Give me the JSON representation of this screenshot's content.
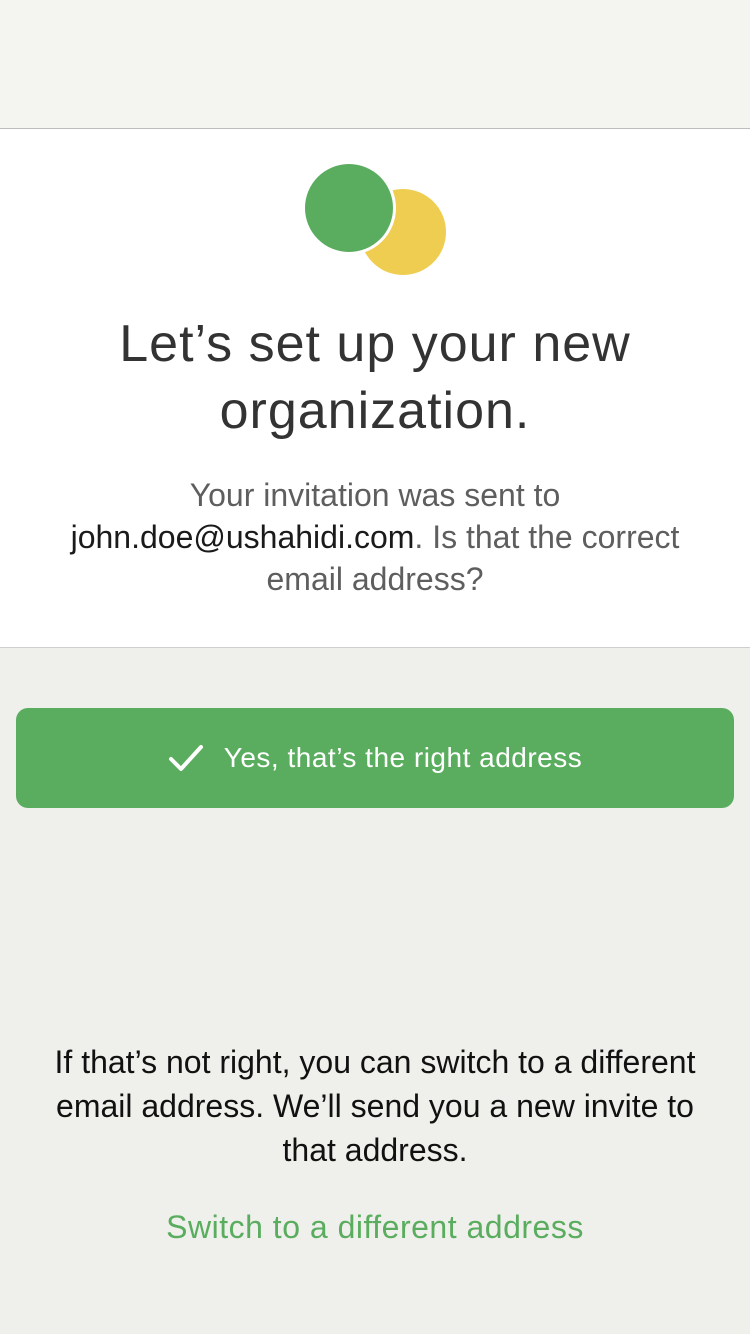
{
  "colors": {
    "brand_green": "#5aad5f",
    "brand_yellow": "#efcd50",
    "background": "#efefeb",
    "card": "#ffffff",
    "title_text": "#333333",
    "body_text": "#5e5e5e"
  },
  "logo": {
    "name": "ushahidi-logo",
    "green_circle_color": "#5aad5f",
    "yellow_circle_color": "#efcd50"
  },
  "header": {
    "title": "Let’s set up your new organization."
  },
  "invitation": {
    "prefix": "Your invitation was sent to ",
    "email": "john.doe@ushahidi.com",
    "suffix": ". Is that the correct email address?"
  },
  "confirm_button": {
    "icon": "check-icon",
    "label": "Yes, that’s the right address"
  },
  "note": {
    "text": "If that’s not right, you can switch to a different email address. We’ll send you a new invite to that address."
  },
  "switch_link": {
    "label": "Switch to a different address"
  }
}
